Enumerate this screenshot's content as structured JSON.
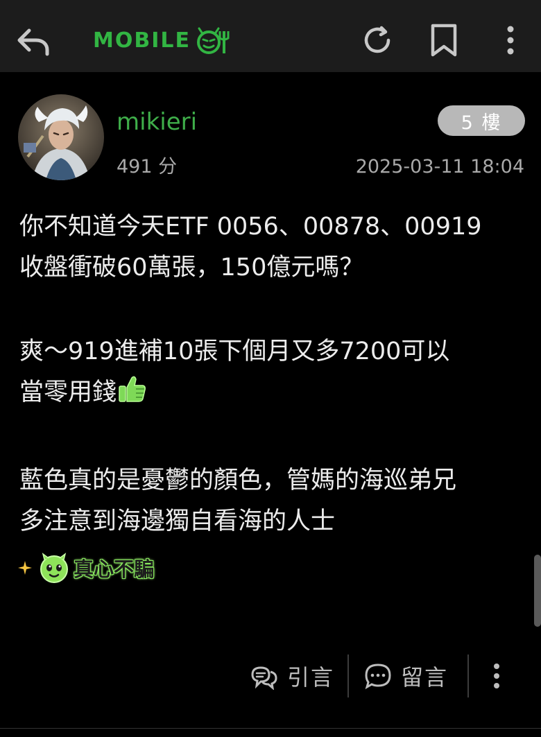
{
  "toolbar": {
    "logo_text": "MOBILE",
    "accent_color": "#32b543",
    "icons": [
      "back-arrow-icon",
      "refresh-icon",
      "bookmark-icon",
      "more-vertical-icon"
    ]
  },
  "post": {
    "author": "mikieri",
    "score": "491 分",
    "floor": "5 樓",
    "timestamp": "2025-03-11 18:04",
    "paragraphs": [
      "你不知道今天ETF 0056、00878、00919",
      "收盤衝破60萬張，150億元嗎？",
      "爽～919進補10張下個月又多7200可以",
      "當零用錢",
      "藍色真的是憂鬱的顏色，管媽的海巡弟兄",
      "多注意到海邊獨自看海的人士"
    ],
    "inline_emoji": "thumbs-up-emoji",
    "signature_text": "真心不騙",
    "signature_icons": [
      "sparkle-icon",
      "green-face-emoji"
    ]
  },
  "actions": {
    "quote_label": "引言",
    "reply_label": "留言"
  }
}
